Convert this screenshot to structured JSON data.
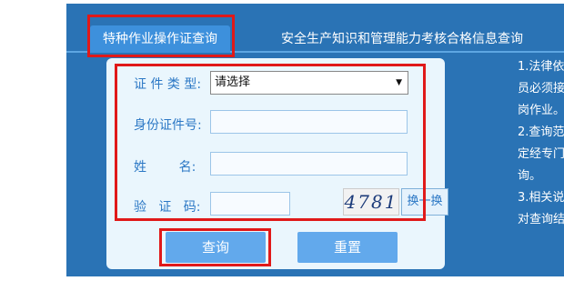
{
  "tabs": {
    "active": "特种作业操作证查询",
    "other": "安全生产知识和管理能力考核合格信息查询"
  },
  "form": {
    "cert_type_label": "证 件 类 型:",
    "cert_type_value": "请选择",
    "id_label": "身份证件号:",
    "name_label": "姓        名:",
    "captcha_label": "验   证   码:",
    "captcha_image_text": "4781",
    "refresh_label": "换一换"
  },
  "buttons": {
    "query": "查询",
    "reset": "重置"
  },
  "notes": [
    "1.法律依",
    "员必须接",
    "岗作业。",
    "2.查询范",
    "定经专门",
    "询。",
    "3.相关说",
    "对查询结"
  ],
  "colors": {
    "panel": "#2a73b5",
    "highlight": "#e01919",
    "button": "#62a9ec"
  }
}
